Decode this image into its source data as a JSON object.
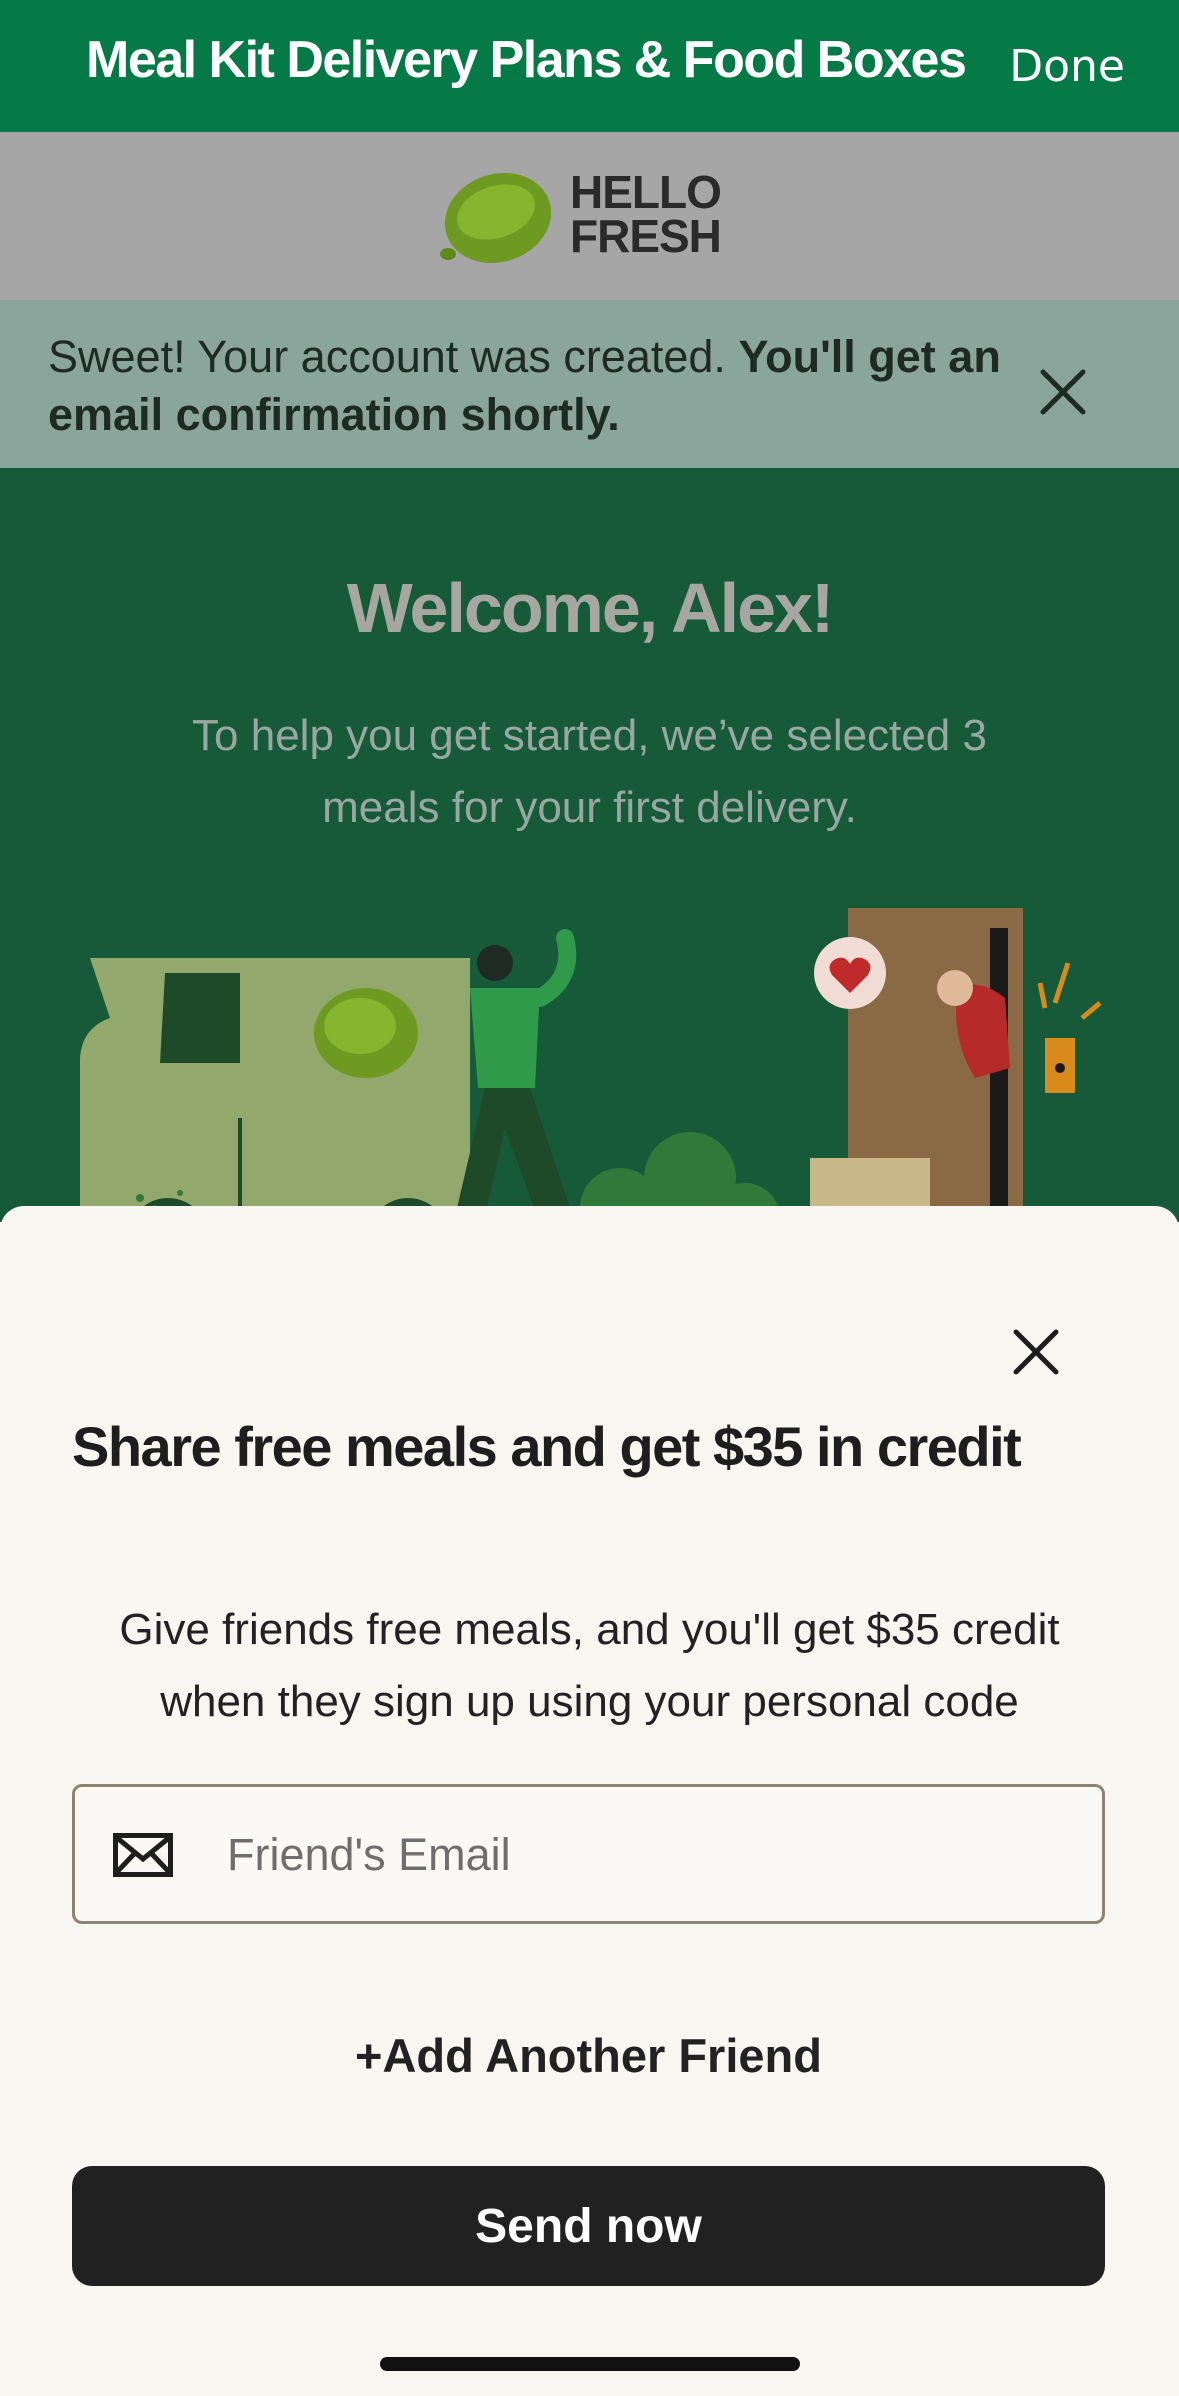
{
  "browser_bar": {
    "title": "Meal Kit Delivery Plans & Food Boxes",
    "done_label": "Done",
    "color": "#067a46"
  },
  "header": {
    "logo_line1": "HELLO",
    "logo_line2": "FRESH"
  },
  "banner": {
    "message_regular": "Sweet! Your account was created. ",
    "message_bold": "You'll get an email confirmation shortly.",
    "close_icon": "close-icon"
  },
  "hero": {
    "welcome": "Welcome, Alex!",
    "intro": "To help you get started, we’ve selected 3 meals for your first delivery."
  },
  "share_sheet": {
    "heading": "Share free meals and get $35 in credit",
    "description": "Give friends free meals, and you'll get $35 credit when they sign up using your personal code",
    "email_placeholder": "Friend's Email",
    "email_icon": "envelope-icon",
    "add_friend_label": "+Add Another Friend",
    "send_label": "Send now",
    "close_icon": "close-icon"
  }
}
